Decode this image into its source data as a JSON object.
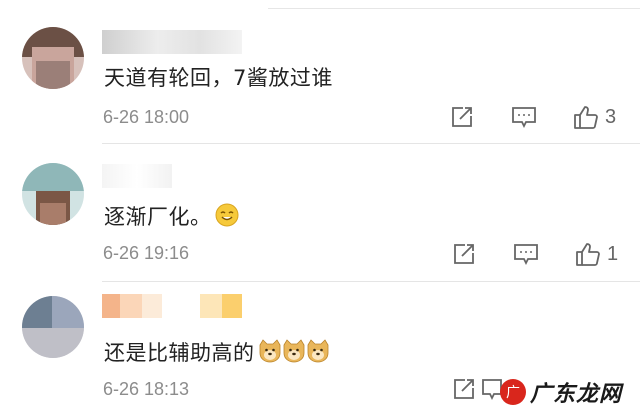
{
  "comments": [
    {
      "username": "g",
      "text": "天道有轮回，7酱放过谁",
      "timestamp": "6-26 18:00",
      "like_count": "3",
      "emoji": "",
      "avatar_colors": [
        "#6b5045",
        "#c9a59c",
        "#9b7f78",
        "#d7c1bb"
      ]
    },
    {
      "username": "",
      "text": "逐渐厂化。",
      "timestamp": "6-26 19:16",
      "like_count": "1",
      "emoji": "smile-emoji",
      "avatar_colors": [
        "#8fb7b8",
        "#d1e3e3",
        "#7b5746",
        "#a97d6a"
      ]
    },
    {
      "username": "",
      "text": "还是比辅助高的",
      "timestamp": "6-26 18:13",
      "like_count": "",
      "emoji": "doge-emoji",
      "avatar_colors": [
        "#6d7f92",
        "#9ba6bb",
        "#bfbfc7",
        "#d9d9de"
      ]
    }
  ],
  "watermark": {
    "logo_char": "广",
    "text": "广东龙网"
  },
  "colors": {
    "text": "#222222",
    "timestamp": "#8c8c8c",
    "icon": "#666666",
    "divider": "#e5e5e5",
    "emoji_yellow": "#f6c93a",
    "watermark_red": "#d9261c"
  }
}
